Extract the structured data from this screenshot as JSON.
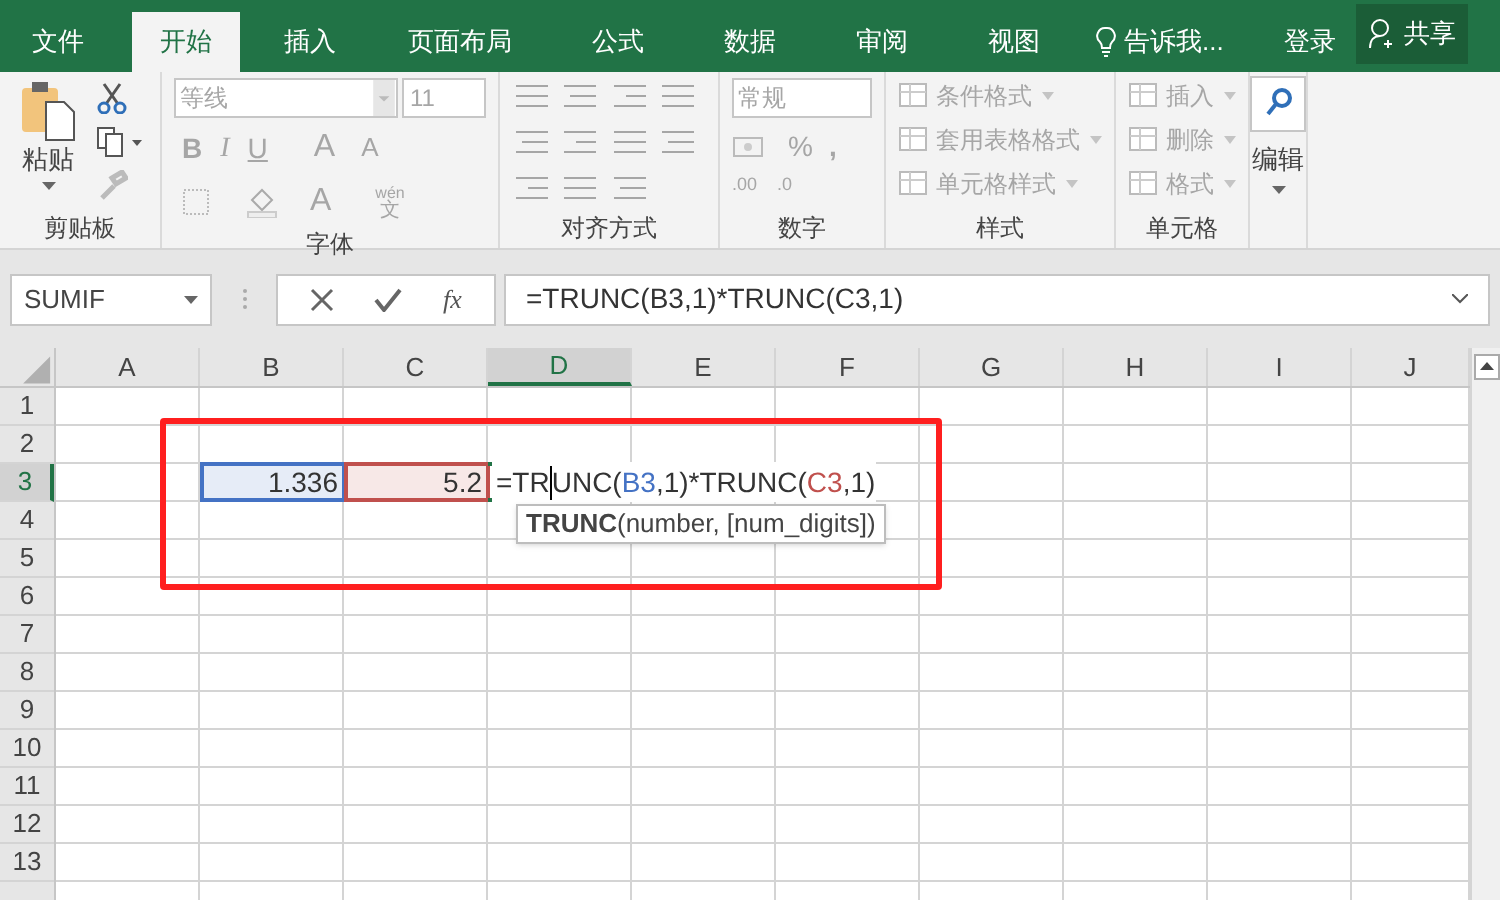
{
  "tabs": [
    {
      "label": "文件",
      "selected": false
    },
    {
      "label": "开始",
      "selected": true
    },
    {
      "label": "插入",
      "selected": false
    },
    {
      "label": "页面布局",
      "selected": false
    },
    {
      "label": "公式",
      "selected": false
    },
    {
      "label": "数据",
      "selected": false
    },
    {
      "label": "审阅",
      "selected": false
    },
    {
      "label": "视图",
      "selected": false
    }
  ],
  "tell_me": "告诉我...",
  "account": {
    "login": "登录",
    "share": "共享"
  },
  "ribbon": {
    "clipboard": {
      "label": "剪贴板",
      "paste": "粘贴",
      "disabled": false
    },
    "font": {
      "label": "字体",
      "font_name": "等线",
      "font_size": "11",
      "disabled": true,
      "style_buttons": [
        "B",
        "I",
        "U"
      ],
      "size_buttons": [
        "A",
        "A"
      ],
      "font_color": "A",
      "phonetic_top": "wén",
      "phonetic_bottom": "文"
    },
    "alignment": {
      "label": "对齐方式",
      "disabled": true
    },
    "number": {
      "label": "数字",
      "format": "常规",
      "disabled": true,
      "percent": "%",
      "comma": ",",
      "increase_decimal": ".00",
      "decrease_decimal": ".0"
    },
    "styles": {
      "label": "样式",
      "disabled": true,
      "items": [
        "条件格式",
        "套用表格格式",
        "单元格样式"
      ]
    },
    "cells": {
      "label": "单元格",
      "disabled": true,
      "items": [
        "插入",
        "删除",
        "格式"
      ]
    },
    "editing": {
      "label": "编辑",
      "disabled": false
    }
  },
  "formula_bar": {
    "name_box": "SUMIF",
    "fx": "fx",
    "formula": "=TRUNC(B3,1)*TRUNC(C3,1)"
  },
  "sheet": {
    "columns": [
      {
        "label": "A",
        "selected": false
      },
      {
        "label": "B",
        "selected": false
      },
      {
        "label": "C",
        "selected": false
      },
      {
        "label": "D",
        "selected": true
      },
      {
        "label": "E",
        "selected": false
      },
      {
        "label": "F",
        "selected": false
      },
      {
        "label": "G",
        "selected": false
      },
      {
        "label": "H",
        "selected": false
      },
      {
        "label": "I",
        "selected": false
      },
      {
        "label": "J",
        "selected": false
      }
    ],
    "rows": [
      {
        "label": "1",
        "selected": false
      },
      {
        "label": "2",
        "selected": false
      },
      {
        "label": "3",
        "selected": true
      },
      {
        "label": "4",
        "selected": false
      },
      {
        "label": "5",
        "selected": false
      },
      {
        "label": "6",
        "selected": false
      },
      {
        "label": "7",
        "selected": false
      },
      {
        "label": "8",
        "selected": false
      },
      {
        "label": "9",
        "selected": false
      },
      {
        "label": "10",
        "selected": false
      },
      {
        "label": "11",
        "selected": false
      },
      {
        "label": "12",
        "selected": false
      },
      {
        "label": "13",
        "selected": false
      }
    ],
    "referenced_cells": [
      {
        "value": "1.336",
        "color": "#4472c4"
      },
      {
        "value": "5.2",
        "color": "#c0504d"
      }
    ],
    "editing_cell": {
      "tokens": [
        {
          "text": "=TR",
          "color": "#333333"
        },
        {
          "text": "UNC(",
          "color": "#333333"
        },
        {
          "text": "B3",
          "color": "#4472c4"
        },
        {
          "text": ",1)*TRUNC(",
          "color": "#333333"
        },
        {
          "text": "C3",
          "color": "#c0504d"
        },
        {
          "text": ",1)",
          "color": "#333333"
        }
      ]
    },
    "tooltip": "**TRUNC**(number, [num_digits])"
  }
}
